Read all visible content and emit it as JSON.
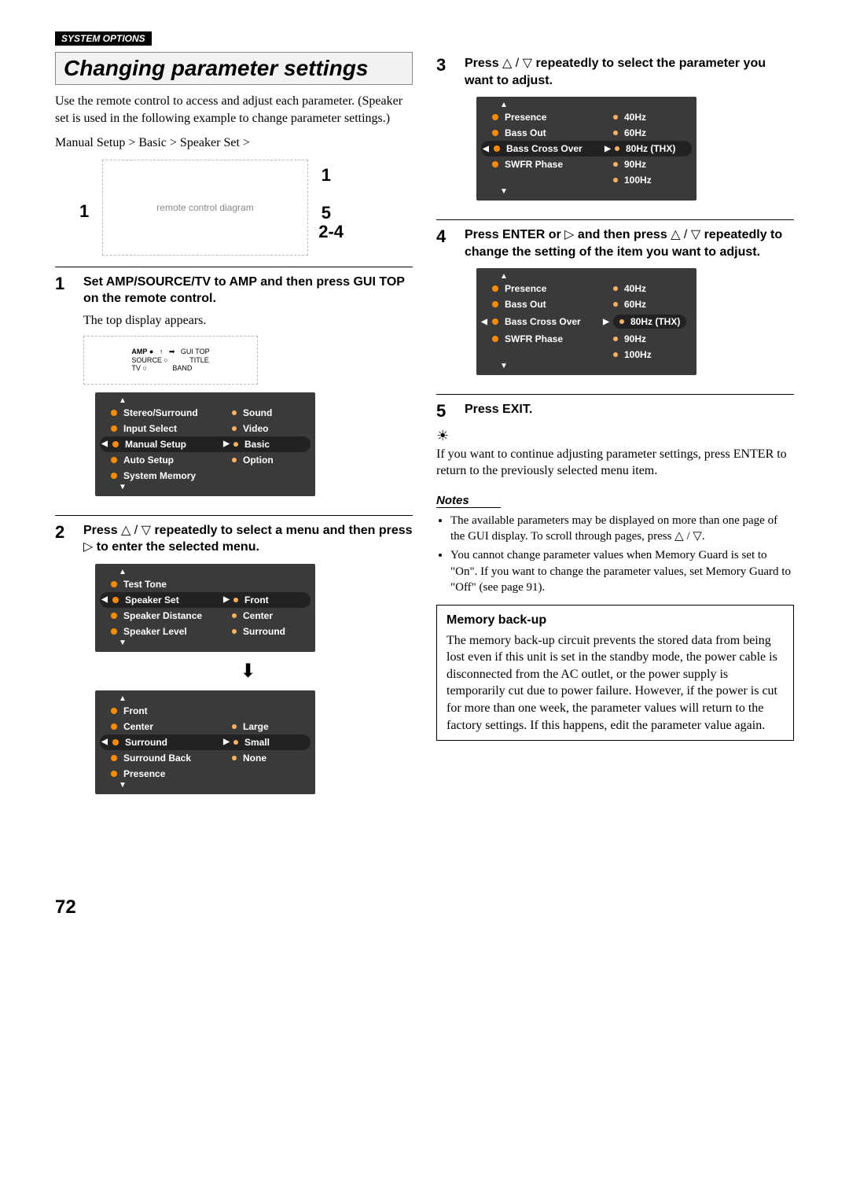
{
  "header": "SYSTEM OPTIONS",
  "title": "Changing parameter settings",
  "intro": "Use the remote control to access and adjust each parameter. (Speaker set is used in the following example to change parameter settings.)",
  "breadcrumb": "Manual Setup > Basic > Speaker Set >",
  "remote_callouts": {
    "top_left": "1",
    "top_right": "1",
    "mid_right": "5",
    "low_right": "2-4"
  },
  "steps": {
    "s1": {
      "num": "1",
      "instr": "Set AMP/SOURCE/TV to AMP and then press GUI TOP on the remote control.",
      "desc": "The top display appears.",
      "switch_labels": {
        "amp": "AMP",
        "source": "SOURCE",
        "tv": "TV",
        "gui_top": "GUI TOP",
        "title": "TITLE",
        "band": "BAND"
      }
    },
    "s2": {
      "num": "2",
      "instr_a": "Press ",
      "instr_b": " repeatedly to select a menu and then press ",
      "instr_c": " to enter the selected menu."
    },
    "s3": {
      "num": "3",
      "instr_a": "Press ",
      "instr_b": " repeatedly to select the parameter you want to adjust."
    },
    "s4": {
      "num": "4",
      "instr_a": "Press ENTER or ",
      "instr_b": " and then press ",
      "instr_c": " repeatedly to change the setting of the item you want to adjust."
    },
    "s5": {
      "num": "5",
      "instr": "Press EXIT."
    }
  },
  "menus": {
    "topmenu": {
      "left": [
        "Stereo/Surround",
        "Input Select",
        "Manual Setup",
        "Auto Setup",
        "System Memory"
      ],
      "right": [
        "Sound",
        "Video",
        "Basic",
        "Option"
      ],
      "selected_left_index": 2,
      "selected_right_index": 2
    },
    "speaker_set": {
      "left": [
        "Test Tone",
        "Speaker Set",
        "Speaker Distance",
        "Speaker Level"
      ],
      "right": [
        "Front",
        "Center",
        "Surround"
      ],
      "selected_left_index": 1,
      "selected_right_index": 0
    },
    "surround": {
      "left": [
        "Front",
        "Center",
        "Surround",
        "Surround Back",
        "Presence"
      ],
      "right": [
        "Large",
        "Small",
        "None"
      ],
      "selected_left_index": 2,
      "selected_right_index": 1
    },
    "bass": {
      "left": [
        "Presence",
        "Bass Out",
        "Bass Cross Over",
        "SWFR Phase"
      ],
      "right": [
        "40Hz",
        "60Hz",
        "80Hz (THX)",
        "90Hz",
        "100Hz"
      ],
      "selected_left_index": 2,
      "selected_right_index": 2
    }
  },
  "tip_text": "If you want to continue adjusting parameter settings, press ENTER to return to the previously selected menu item.",
  "notes_label": "Notes",
  "notes": [
    "The available parameters may be displayed on more than one page of the GUI display. To scroll through pages, press △ / ▽.",
    "You cannot change parameter values when Memory Guard is set to \"On\". If you want to change the parameter values, set Memory Guard to \"Off\" (see page 91)."
  ],
  "memory": {
    "title": "Memory back-up",
    "body": "The memory back-up circuit prevents the stored data from being lost even if this unit is set in the standby mode, the power cable is disconnected from the AC outlet, or the power supply is temporarily cut due to power failure. However, if the power is cut for more than one week, the parameter values will return to the factory settings. If this happens, edit the parameter value again."
  },
  "page_number": "72",
  "icons": {
    "up_down": "△ / ▽",
    "right": "▷"
  }
}
